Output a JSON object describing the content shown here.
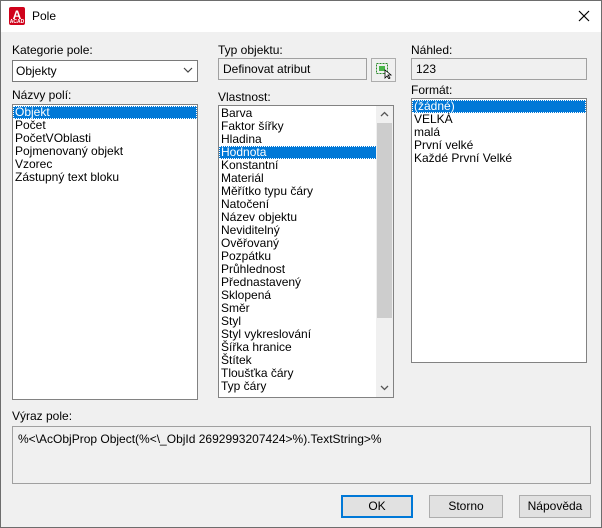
{
  "window": {
    "title": "Pole",
    "app_icon_letter": "A",
    "app_icon_sub": "ACAD"
  },
  "category": {
    "label": "Kategorie pole:",
    "value": "Objekty"
  },
  "field_names": {
    "label": "Názvy polí:",
    "items": [
      "Objekt",
      "Počet",
      "PočetVOblasti",
      "Pojmenovaný objekt",
      "Vzorec",
      "Zástupný text bloku"
    ],
    "selected_index": 0
  },
  "object_type": {
    "label": "Typ objektu:",
    "value": "Definovat atribut"
  },
  "property": {
    "label": "Vlastnost:",
    "items": [
      "Barva",
      "Faktor šířky",
      "Hladina",
      "Hodnota",
      "Konstantní",
      "Materiál",
      "Měřítko typu čáry",
      "Natočení",
      "Název objektu",
      "Neviditelný",
      "Ověřovaný",
      "Pozpátku",
      "Průhlednost",
      "Přednastavený",
      "Sklopená",
      "Směr",
      "Styl",
      "Styl vykreslování",
      "Šířka hranice",
      "Štítek",
      "Tloušťka čáry",
      "Typ čáry"
    ],
    "selected_index": 3
  },
  "preview": {
    "label": "Náhled:",
    "value": "123"
  },
  "format": {
    "label": "Formát:",
    "items": [
      "(žádné)",
      "VELKÁ",
      "malá",
      "První velké",
      "Každé První Velké"
    ],
    "selected_index": 0
  },
  "expression": {
    "label": "Výraz pole:",
    "value": "%<\\AcObjProp Object(%<\\_ObjId 2692993207424>%).TextString>%"
  },
  "buttons": {
    "ok": "OK",
    "cancel": "Storno",
    "help": "Nápověda"
  },
  "colors": {
    "selection": "#0078d7",
    "dialog_bg": "#f0f0f0",
    "app_icon": "#d0021b"
  }
}
